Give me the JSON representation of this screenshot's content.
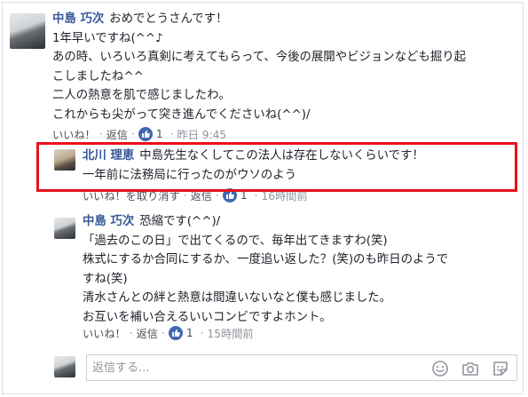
{
  "comments": [
    {
      "author": "中島 巧次",
      "lines": [
        "おめでとうさんです！",
        "1年早いですね(^^♪",
        "あの時、いろいろ真剣に考えてもらって、今後の展開やビジョンなども掘り起",
        "こしましたね^^",
        "二人の熱意を肌で感じましたわ。",
        "これからも尖がって突き進んでくださいね(^^)/"
      ],
      "actions": {
        "like": "いいね！",
        "reply": "返信",
        "like_count": "1",
        "time": "昨日 9:45"
      }
    },
    {
      "author": "北川 理恵",
      "lines": [
        "中島先生なくしてこの法人は存在しないくらいです！",
        "一年前に法務局に行ったのがウソのよう"
      ],
      "actions": {
        "like": "いいね！を取り消す",
        "reply": "返信",
        "like_count": "1",
        "time": "16時間前"
      }
    },
    {
      "author": "中島 巧次",
      "lines": [
        "恐縮です(^^)/",
        "「過去のこの日」で出てくるので、毎年出てきますわ(笑)",
        "株式にするか合同にするか、一度追い返した？(笑)のも昨日のようで",
        "すね(笑)",
        "清水さんとの絆と熱意は間違いないなと僕も感じました。",
        "お互いを補い合えるいいコンビですよホント。"
      ],
      "actions": {
        "like": "いいね！",
        "reply": "返信",
        "like_count": "1",
        "time": "15時間前"
      }
    }
  ],
  "reply_box": {
    "placeholder": "返信する..."
  },
  "colors": {
    "link": "#365899",
    "highlight": "#e8121c",
    "like_badge": "#4267b2"
  }
}
